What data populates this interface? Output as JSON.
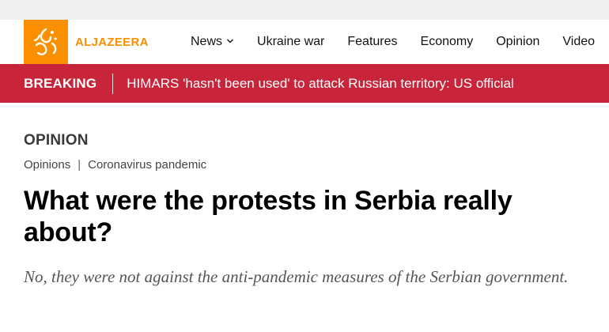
{
  "brand": {
    "name": "ALJAZEERA",
    "color": "#fa9000"
  },
  "nav": {
    "items": [
      {
        "label": "News",
        "has_dropdown": true,
        "icon": "chevron-down-icon"
      },
      {
        "label": "Ukraine war"
      },
      {
        "label": "Features"
      },
      {
        "label": "Economy"
      },
      {
        "label": "Opinion"
      },
      {
        "label": "Video"
      }
    ]
  },
  "breaking": {
    "label": "BREAKING",
    "text": "HIMARS 'hasn't been used' to attack Russian territory: US official",
    "color": "#c8253b"
  },
  "article": {
    "kicker": "OPINION",
    "breadcrumbs": [
      "Opinions",
      "Coronavirus pandemic"
    ],
    "breadcrumb_separator": "|",
    "headline": "What were the protests in Serbia really about?",
    "standfirst": "No, they were not against the anti-pandemic measures of the Serbian government."
  }
}
